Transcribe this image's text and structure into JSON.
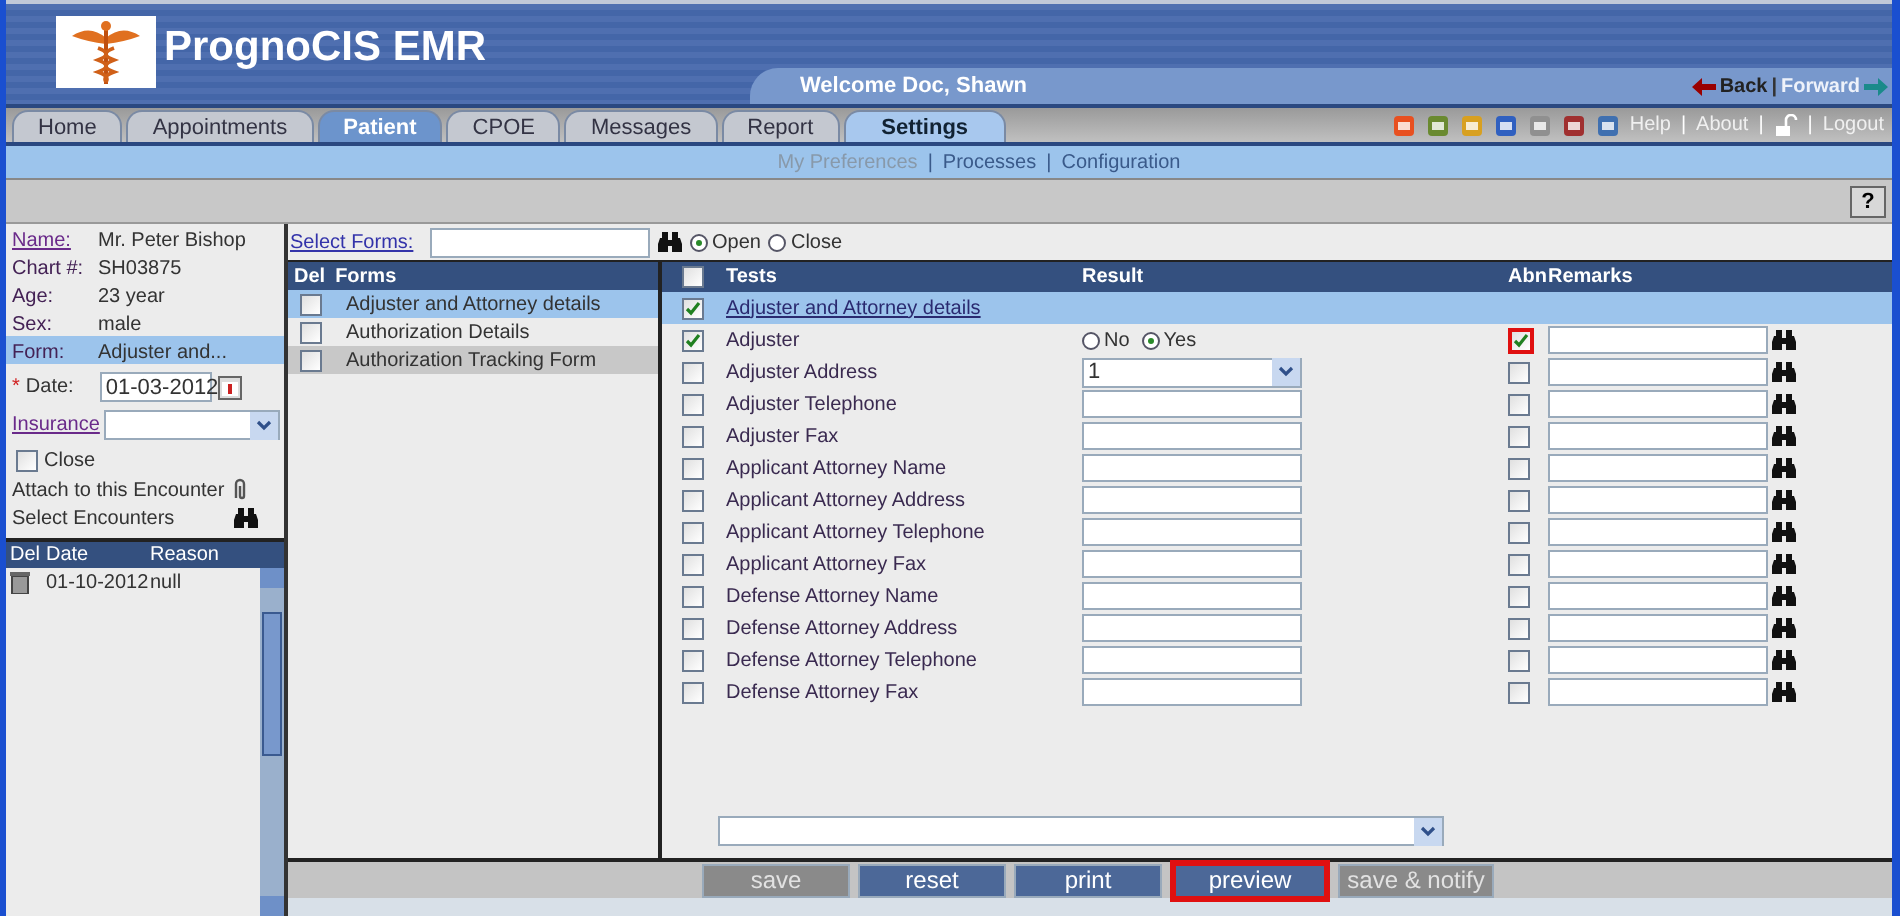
{
  "header": {
    "app_title": "PrognoCIS EMR",
    "welcome": "Welcome Doc, Shawn",
    "back": "Back",
    "forward": "Forward",
    "forward_disabled": true,
    "separator": "|"
  },
  "toolbar_separator": "|",
  "subnav_separator": "|",
  "tabs": [
    {
      "label": "Home",
      "selected": false,
      "highlighted": false
    },
    {
      "label": "Appointments",
      "selected": false,
      "highlighted": false
    },
    {
      "label": "Patient",
      "selected": true,
      "highlighted": false
    },
    {
      "label": "CPOE",
      "selected": false,
      "highlighted": false
    },
    {
      "label": "Messages",
      "selected": false,
      "highlighted": false
    },
    {
      "label": "Report",
      "selected": false,
      "highlighted": false
    },
    {
      "label": "Settings",
      "selected": false,
      "highlighted": true
    }
  ],
  "toolbar_links": [
    "Help",
    "About",
    "Logout"
  ],
  "subnav": [
    {
      "label": "My Preferences",
      "disabled": true
    },
    {
      "label": "Processes",
      "disabled": false
    },
    {
      "label": "Configuration",
      "disabled": false
    }
  ],
  "help_button": "?",
  "patient": {
    "fields": [
      {
        "label": "Name:",
        "value": "Mr. Peter Bishop",
        "link": true,
        "selected": false
      },
      {
        "label": "Chart #:",
        "value": "SH03875",
        "link": false,
        "selected": false
      },
      {
        "label": "Age:",
        "value": "23 year",
        "link": false,
        "selected": false
      },
      {
        "label": "Sex:",
        "value": "male",
        "link": false,
        "selected": false
      },
      {
        "label": "Form:",
        "value": "Adjuster and...",
        "link": false,
        "selected": true
      }
    ],
    "required_mark": "*",
    "date_label": "Date:",
    "date_value": "01-03-2012",
    "insurance_label": "Insurance",
    "close_label": "Close",
    "close_checked": false,
    "attach_label": "Attach to this Encounter",
    "select_encounters": "Select Encounters"
  },
  "encounters": {
    "columns": [
      "Del",
      "Date",
      "Reason"
    ],
    "rows": [
      {
        "date": "01-10-2012",
        "reason": "null"
      }
    ]
  },
  "select_forms": {
    "label": "Select Forms:",
    "options": [
      {
        "label": "Open",
        "selected": true
      },
      {
        "label": "Close",
        "selected": false
      }
    ]
  },
  "forms": {
    "columns": [
      "Del",
      "Forms"
    ],
    "rows": [
      {
        "name": "Adjuster and Attorney details",
        "checked": false,
        "selected": true,
        "hovered": false
      },
      {
        "name": "Authorization Details",
        "checked": false,
        "selected": false,
        "hovered": false
      },
      {
        "name": "Authorization Tracking Form",
        "checked": false,
        "selected": false,
        "hovered": true
      }
    ]
  },
  "tests": {
    "header_checked": false,
    "columns": [
      "Tests",
      "Result",
      "Abn",
      "Remarks"
    ],
    "rows": [
      {
        "kind": "section",
        "name": "Adjuster and Attorney details",
        "checked": true
      },
      {
        "kind": "radio",
        "name": "Adjuster",
        "checked": true,
        "options": [
          {
            "label": "No",
            "selected": false
          },
          {
            "label": "Yes",
            "selected": true
          }
        ],
        "abn": true,
        "abn_highlighted": true
      },
      {
        "kind": "select",
        "name": "Adjuster Address",
        "checked": false,
        "value": "1",
        "abn": false,
        "abn_highlighted": false
      },
      {
        "kind": "text",
        "name": "Adjuster Telephone",
        "checked": false,
        "abn": false,
        "abn_highlighted": false
      },
      {
        "kind": "text",
        "name": "Adjuster Fax",
        "checked": false,
        "abn": false,
        "abn_highlighted": false
      },
      {
        "kind": "text",
        "name": "Applicant Attorney Name",
        "checked": false,
        "abn": false,
        "abn_highlighted": false
      },
      {
        "kind": "text",
        "name": "Applicant Attorney Address",
        "checked": false,
        "abn": false,
        "abn_highlighted": false
      },
      {
        "kind": "text",
        "name": "Applicant Attorney Telephone",
        "checked": false,
        "abn": false,
        "abn_highlighted": false
      },
      {
        "kind": "text",
        "name": "Applicant Attorney Fax",
        "checked": false,
        "abn": false,
        "abn_highlighted": false
      },
      {
        "kind": "text",
        "name": "Defense Attorney Name",
        "checked": false,
        "abn": false,
        "abn_highlighted": false
      },
      {
        "kind": "text",
        "name": "Defense Attorney Address",
        "checked": false,
        "abn": false,
        "abn_highlighted": false
      },
      {
        "kind": "text",
        "name": "Defense Attorney Telephone",
        "checked": false,
        "abn": false,
        "abn_highlighted": false
      },
      {
        "kind": "text",
        "name": "Defense Attorney Fax",
        "checked": false,
        "abn": false,
        "abn_highlighted": false
      }
    ]
  },
  "buttons": [
    {
      "label": "save",
      "disabled": true,
      "highlighted": false
    },
    {
      "label": "reset",
      "disabled": false,
      "highlighted": false
    },
    {
      "label": "print",
      "disabled": false,
      "highlighted": false
    },
    {
      "label": "preview",
      "disabled": false,
      "highlighted": true
    },
    {
      "label": "save & notify",
      "disabled": true,
      "highlighted": false
    }
  ]
}
